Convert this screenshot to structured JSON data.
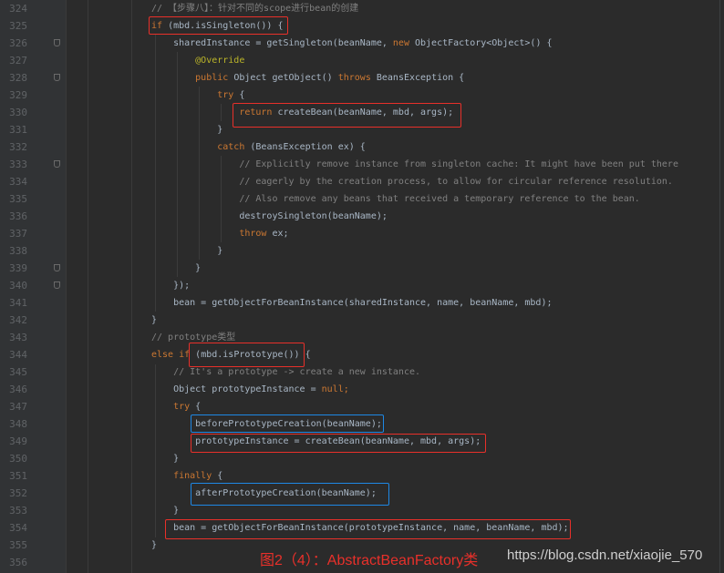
{
  "editor": {
    "lines": [
      {
        "num": "324",
        "fold": false,
        "tokens": [
          [
            "cm",
            "// 【步骤八】：针对不同的scope进行bean的创建"
          ]
        ]
      },
      {
        "num": "325",
        "fold": false,
        "tokens": [
          [
            "kw",
            "if"
          ],
          [
            "pl",
            " (mbd.isSingleton()) {"
          ]
        ]
      },
      {
        "num": "326",
        "fold": true,
        "tokens": [
          [
            "pl",
            "    sharedInstance = getSingleton(beanName, "
          ],
          [
            "kw",
            "new"
          ],
          [
            "pl",
            " ObjectFactory<Object>() {"
          ]
        ]
      },
      {
        "num": "327",
        "fold": false,
        "tokens": [
          [
            "an",
            "        @Override"
          ]
        ]
      },
      {
        "num": "328",
        "fold": true,
        "tokens": [
          [
            "kw",
            "        public"
          ],
          [
            "pl",
            " Object getObject() "
          ],
          [
            "kw",
            "throws"
          ],
          [
            "pl",
            " BeansException {"
          ]
        ]
      },
      {
        "num": "329",
        "fold": false,
        "tokens": [
          [
            "kw",
            "            try"
          ],
          [
            "pl",
            " {"
          ]
        ]
      },
      {
        "num": "330",
        "fold": false,
        "tokens": [
          [
            "kw",
            "                return"
          ],
          [
            "pl",
            " createBean(beanName, mbd, args);"
          ]
        ]
      },
      {
        "num": "331",
        "fold": false,
        "tokens": [
          [
            "pl",
            "            }"
          ]
        ]
      },
      {
        "num": "332",
        "fold": false,
        "tokens": [
          [
            "kw",
            "            catch"
          ],
          [
            "pl",
            " (BeansException ex) {"
          ]
        ]
      },
      {
        "num": "333",
        "fold": true,
        "tokens": [
          [
            "cm",
            "                // Explicitly remove instance from singleton cache: It might have been put there"
          ]
        ]
      },
      {
        "num": "334",
        "fold": false,
        "tokens": [
          [
            "cm",
            "                // eagerly by the creation process, to allow for circular reference resolution."
          ]
        ]
      },
      {
        "num": "335",
        "fold": false,
        "tokens": [
          [
            "cm",
            "                // Also remove any beans that received a temporary reference to the bean."
          ]
        ]
      },
      {
        "num": "336",
        "fold": false,
        "tokens": [
          [
            "pl",
            "                destroySingleton(beanName);"
          ]
        ]
      },
      {
        "num": "337",
        "fold": false,
        "tokens": [
          [
            "kw",
            "                throw"
          ],
          [
            "pl",
            " ex;"
          ]
        ]
      },
      {
        "num": "338",
        "fold": false,
        "tokens": [
          [
            "pl",
            "            }"
          ]
        ]
      },
      {
        "num": "339",
        "fold": true,
        "tokens": [
          [
            "pl",
            "        }"
          ]
        ]
      },
      {
        "num": "340",
        "fold": true,
        "tokens": [
          [
            "pl",
            "    });"
          ]
        ]
      },
      {
        "num": "341",
        "fold": false,
        "tokens": [
          [
            "pl",
            "    bean = getObjectForBeanInstance(sharedInstance, name, beanName, mbd);"
          ]
        ]
      },
      {
        "num": "342",
        "fold": false,
        "tokens": [
          [
            "pl",
            "}"
          ]
        ]
      },
      {
        "num": "343",
        "fold": false,
        "tokens": [
          [
            "cm",
            "// prototype类型"
          ]
        ]
      },
      {
        "num": "344",
        "fold": false,
        "tokens": [
          [
            "kw",
            "else if"
          ],
          [
            "pl",
            " (mbd.isPrototype()) {"
          ]
        ]
      },
      {
        "num": "345",
        "fold": false,
        "tokens": [
          [
            "cm",
            "    // It's a prototype -> create a new instance."
          ]
        ]
      },
      {
        "num": "346",
        "fold": false,
        "tokens": [
          [
            "pl",
            "    Object prototypeInstance = "
          ],
          [
            "kw",
            "null;"
          ]
        ]
      },
      {
        "num": "347",
        "fold": false,
        "tokens": [
          [
            "kw",
            "    try"
          ],
          [
            "pl",
            " {"
          ]
        ]
      },
      {
        "num": "348",
        "fold": false,
        "tokens": [
          [
            "pl",
            "        beforePrototypeCreation(beanName);"
          ]
        ]
      },
      {
        "num": "349",
        "fold": false,
        "tokens": [
          [
            "pl",
            "        prototypeInstance = createBean(beanName, mbd, args);"
          ]
        ]
      },
      {
        "num": "350",
        "fold": false,
        "tokens": [
          [
            "pl",
            "    }"
          ]
        ]
      },
      {
        "num": "351",
        "fold": false,
        "tokens": [
          [
            "kw",
            "    finally"
          ],
          [
            "pl",
            " {"
          ]
        ]
      },
      {
        "num": "352",
        "fold": false,
        "tokens": [
          [
            "pl",
            "        afterPrototypeCreation(beanName);"
          ]
        ]
      },
      {
        "num": "353",
        "fold": false,
        "tokens": [
          [
            "pl",
            "    }"
          ]
        ]
      },
      {
        "num": "354",
        "fold": false,
        "tokens": [
          [
            "pl",
            "    bean = getObjectForBeanInstance(prototypeInstance, name, beanName, mbd);"
          ]
        ]
      },
      {
        "num": "355",
        "fold": false,
        "tokens": [
          [
            "pl",
            "}"
          ]
        ]
      },
      {
        "num": "356",
        "fold": false,
        "tokens": []
      }
    ]
  },
  "annotation": {
    "caption": "图2（4）：AbstractBeanFactory类",
    "watermark": "https://blog.csdn.net/xiaojie_570",
    "highlight_colors": {
      "red": "#e8302a",
      "blue": "#1e88e5"
    }
  }
}
